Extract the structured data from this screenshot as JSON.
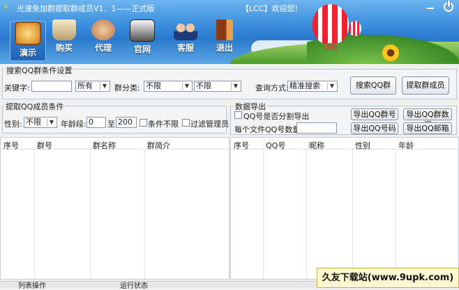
{
  "window": {
    "title": "光速免加群提取群成员V1．1——正式版",
    "welcome": "【LCC】欢迎您!"
  },
  "toolbar": [
    {
      "label": "演示",
      "icon": "tv-icon",
      "active": true
    },
    {
      "label": "购买",
      "icon": "basket-icon",
      "active": false
    },
    {
      "label": "代理",
      "icon": "handshake-icon",
      "active": false
    },
    {
      "label": "官网",
      "icon": "website-icon",
      "active": false
    },
    {
      "label": "客服",
      "icon": "support-icon",
      "active": false
    },
    {
      "label": "退出",
      "icon": "exit-door-icon",
      "active": false
    }
  ],
  "search_group": {
    "title": "搜索QQ群条件设置",
    "keyword_label": "关键字:",
    "keyword_value": "",
    "scope_value": "所有",
    "category_label": "群分类:",
    "category1_value": "不限",
    "category2_value": "不限",
    "mode_label": "查询方式:",
    "mode_value": "精准搜索",
    "search_button": "搜索QQ群",
    "extract_button": "提取群成员"
  },
  "member_group": {
    "title": "提取QQ成员条件",
    "gender_label": "性别:",
    "gender_value": "不限",
    "age_label": "年龄段:",
    "age_from": "0",
    "age_to_label": "至",
    "age_to": "200",
    "unlimited_label": "条件不限",
    "filter_admin_label": "过滤管理员"
  },
  "export_group": {
    "title": "数据导出",
    "split_label": "QQ号是否分割导出",
    "per_file_label": "每个文件QQ号数量:",
    "per_file_value": "",
    "export_group_no": "导出QQ群号",
    "export_group_data": "导出QQ群数据",
    "export_qq_no": "导出QQ号码",
    "export_qq_mail": "导出QQ邮箱"
  },
  "group_table": {
    "columns": [
      "序号",
      "群号",
      "群名称",
      "群简介"
    ]
  },
  "member_table": {
    "columns": [
      "序号",
      "QQ号",
      "昵称",
      "性别",
      "年龄"
    ]
  },
  "status": {
    "list_ops": "列表操作",
    "run_status": "运行状态"
  },
  "watermark": "久友下载站(www.9upk.com)"
}
